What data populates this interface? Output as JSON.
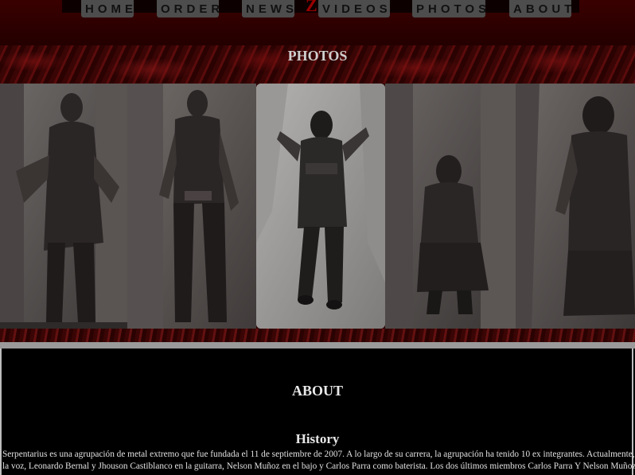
{
  "nav": {
    "items": [
      {
        "label": "HOME"
      },
      {
        "label": "ORDER"
      },
      {
        "label": "NEWS"
      },
      {
        "label": "VIDEOS"
      },
      {
        "label": "PHOTOS"
      },
      {
        "label": "ABOUT"
      }
    ]
  },
  "photos_section": {
    "title": "PHOTOS",
    "images": [
      {
        "name": "band-member-1-photo"
      },
      {
        "name": "band-member-2-photo"
      },
      {
        "name": "band-member-3-photo"
      },
      {
        "name": "band-member-4-photo"
      },
      {
        "name": "band-member-5-photo"
      }
    ]
  },
  "about_section": {
    "title": "ABOUT",
    "history_title": "History",
    "history_line1": "Serpentarius es una agrupación de metal extremo que fue fundada el 11 de septiembre de 2007. A lo largo de su carrera, la agrupación ha tenido 10 ex integrantes. Actualmente, sus miembros son Aleran e",
    "history_line2": "la voz, Leonardo Bernal y Jhouson Castiblanco en la guitarra, Nelson Muñoz en el bajo y Carlos Parra como baterista. Los dos últimos miembros Carlos Parra Y Nelson Muñoz han estado en la agrupació"
  },
  "colors": {
    "header": "#2c0000",
    "nav_button": "#4d4d4d",
    "band_red": "#5a0b0b",
    "text_light": "#e0e0e0"
  }
}
